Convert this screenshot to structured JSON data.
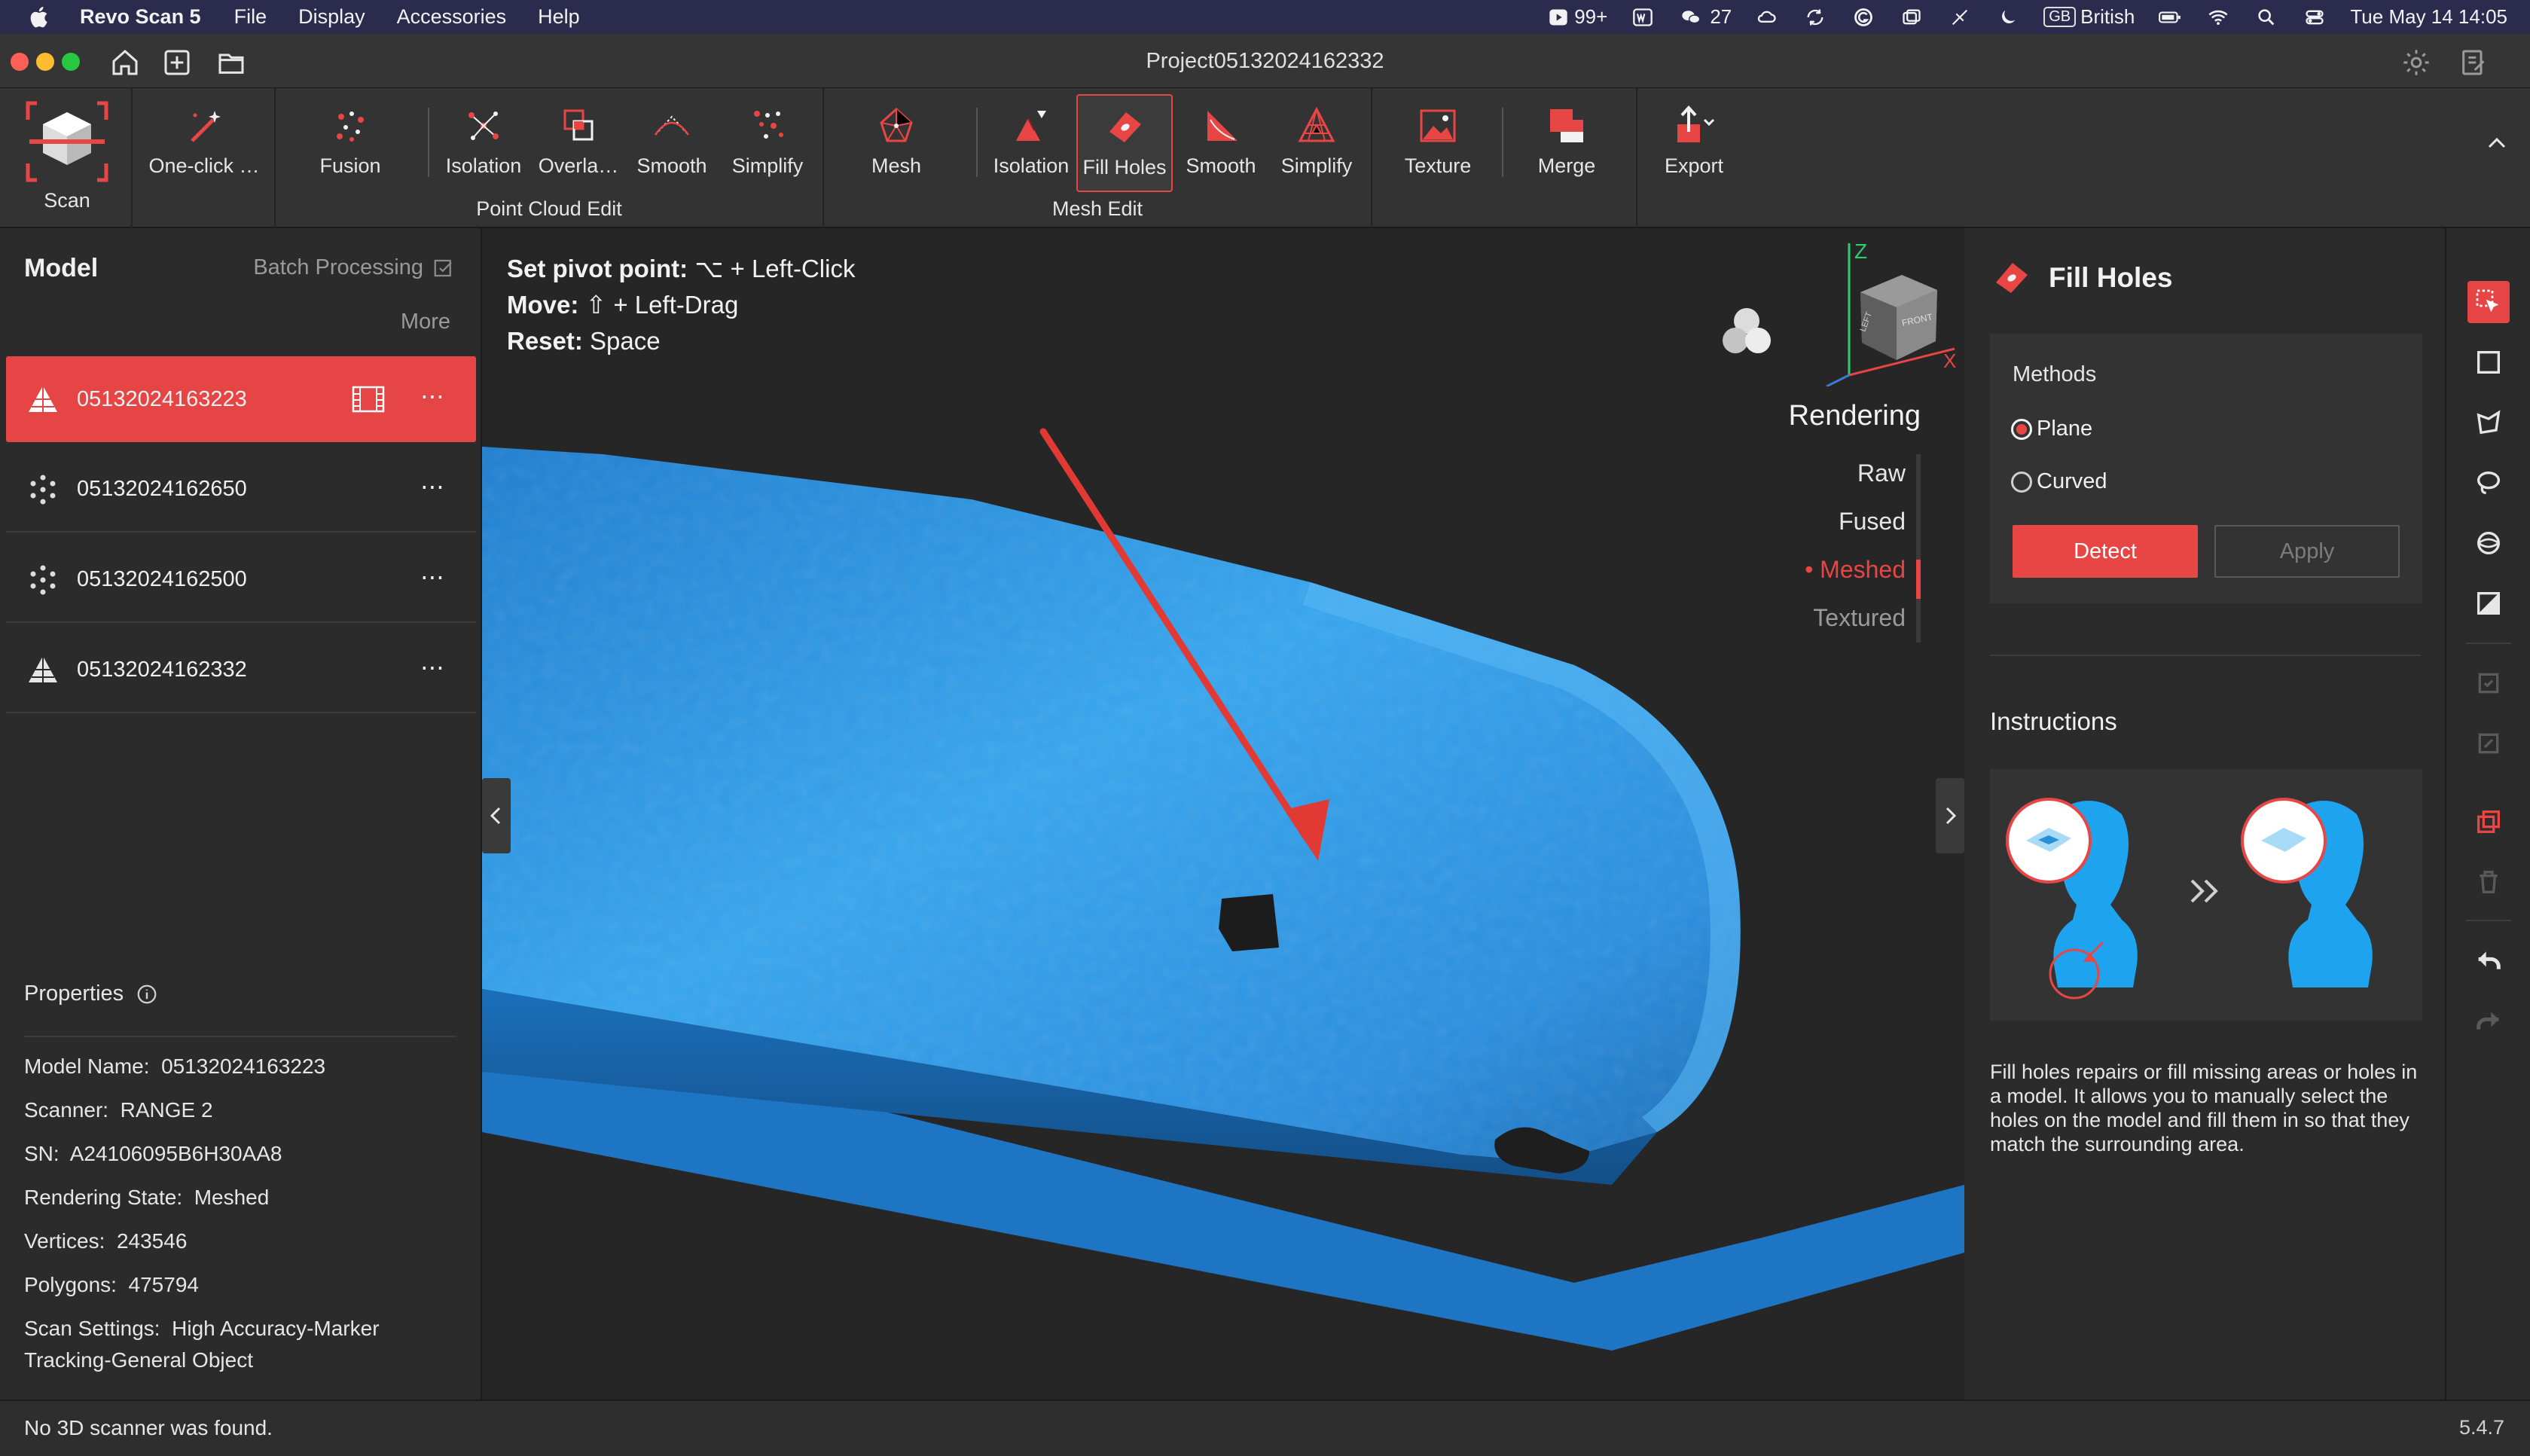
{
  "menubar": {
    "app_name": "Revo Scan 5",
    "items": [
      "File",
      "Display",
      "Accessories",
      "Help"
    ],
    "status": {
      "badge_count": "99+",
      "wechat_count": "27",
      "input_source_badge": "GB",
      "input_source": "British",
      "datetime": "Tue May 14  14:05"
    }
  },
  "window": {
    "title": "Project05132024162332"
  },
  "toolbar": {
    "scan_label": "Scan",
    "oneclick_label": "One-click …",
    "fusion_label": "Fusion",
    "point_cloud_edit": {
      "label": "Point Cloud Edit",
      "items": [
        "Isolation",
        "Overla…",
        "Smooth",
        "Simplify"
      ]
    },
    "mesh_label": "Mesh",
    "mesh_edit": {
      "label": "Mesh Edit",
      "items": [
        "Isolation",
        "Fill Holes",
        "Smooth",
        "Simplify"
      ]
    },
    "texture_label": "Texture",
    "merge_label": "Merge",
    "export_label": "Export"
  },
  "left_panel": {
    "title": "Model",
    "batch_label": "Batch Processing",
    "more_label": "More",
    "models": [
      {
        "name": "05132024163223",
        "type": "mesh",
        "selected": true
      },
      {
        "name": "05132024162650",
        "type": "point-cloud",
        "selected": false
      },
      {
        "name": "05132024162500",
        "type": "point-cloud",
        "selected": false
      },
      {
        "name": "05132024162332",
        "type": "mesh",
        "selected": false
      }
    ],
    "dots": "⋯",
    "properties_title": "Properties",
    "properties": [
      {
        "label": "Model Name:",
        "value": "05132024163223"
      },
      {
        "label": "Scanner:",
        "value": "RANGE 2"
      },
      {
        "label": "SN:",
        "value": "A24106095B6H30AA8"
      },
      {
        "label": "Rendering State:",
        "value": "Meshed"
      },
      {
        "label": "Vertices:",
        "value": "243546"
      },
      {
        "label": "Polygons:",
        "value": "475794"
      },
      {
        "label": "Scan Settings:",
        "value": "High Accuracy-Marker Tracking-General Object"
      }
    ]
  },
  "viewport": {
    "hints": [
      {
        "key": "Set pivot point:",
        "value": "⌥ + Left-Click"
      },
      {
        "key": "Move:",
        "value": "⇧ + Left-Drag"
      },
      {
        "key": "Reset:",
        "value": "Space"
      }
    ],
    "rendering_title": "Rendering",
    "rendering_options": [
      "Raw",
      "Fused",
      "Meshed",
      "Textured"
    ],
    "rendering_selected": "Meshed",
    "cube": {
      "axis_z": "Z",
      "axis_x": "X",
      "face_front": "FRONT",
      "face_left": "LEFT"
    },
    "mesh_color": "#2f93de"
  },
  "right_panel": {
    "title": "Fill Holes",
    "methods_label": "Methods",
    "methods": [
      "Plane",
      "Curved"
    ],
    "selected_method": "Plane",
    "detect_label": "Detect",
    "apply_label": "Apply",
    "instructions_title": "Instructions",
    "instructions_text": "Fill holes repairs or fill missing areas or holes in a model. It allows you to manually select the holes on the model and fill them in so that they match the surrounding area."
  },
  "status_bar": {
    "message": "No 3D scanner was found.",
    "version": "5.4.7"
  },
  "colors": {
    "accent": "#e84545",
    "panel": "#2b2b2b",
    "viewport": "#262626"
  }
}
